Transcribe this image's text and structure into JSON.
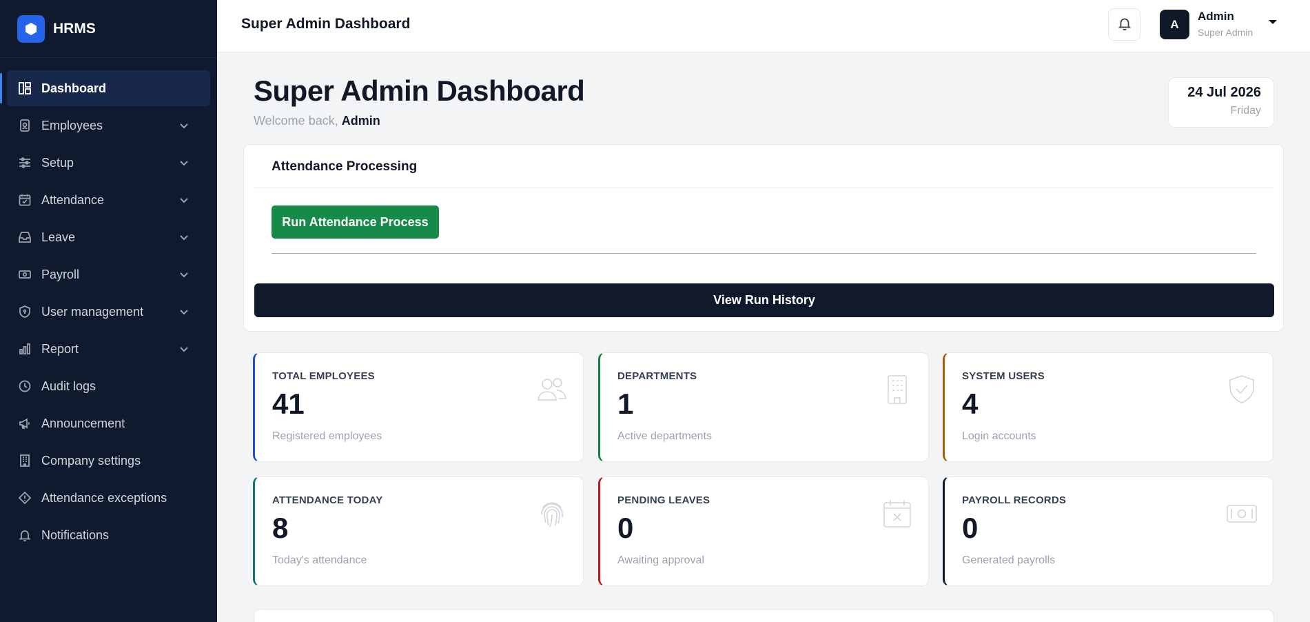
{
  "brand": {
    "name": "HRMS",
    "icon": "hexagon-icon",
    "color": "#2563eb"
  },
  "sidebar": {
    "items": [
      {
        "label": "Dashboard",
        "icon": "dashboard-icon",
        "active": true,
        "expandable": false
      },
      {
        "label": "Employees",
        "icon": "id-badge-icon",
        "expandable": true
      },
      {
        "label": "Setup",
        "icon": "sliders-icon",
        "expandable": true
      },
      {
        "label": "Attendance",
        "icon": "calendar-check-icon",
        "expandable": true
      },
      {
        "label": "Leave",
        "icon": "inbox-icon",
        "expandable": true
      },
      {
        "label": "Payroll",
        "icon": "money-icon",
        "expandable": true
      },
      {
        "label": "User management",
        "icon": "shield-icon",
        "expandable": true
      },
      {
        "label": "Report",
        "icon": "bar-chart-icon",
        "expandable": true
      },
      {
        "label": "Audit logs",
        "icon": "clock-icon",
        "expandable": false
      },
      {
        "label": "Announcement",
        "icon": "megaphone-icon",
        "expandable": false
      },
      {
        "label": "Company settings",
        "icon": "building-icon",
        "expandable": false
      },
      {
        "label": "Attendance exceptions",
        "icon": "alert-diamond-icon",
        "expandable": false
      },
      {
        "label": "Notifications",
        "icon": "bell-icon",
        "expandable": false
      }
    ]
  },
  "topbar": {
    "title": "Super Admin Dashboard",
    "user": {
      "initial": "A",
      "name": "Admin",
      "role": "Super Admin"
    }
  },
  "main": {
    "title": "Super Admin Dashboard",
    "welcome_prefix": "Welcome back,",
    "welcome_name": "Admin",
    "date": "24 Jul 2026",
    "day": "Friday",
    "attendance": {
      "title": "Attendance Processing",
      "run_button": "Run Attendance Process",
      "history_button": "View Run History"
    },
    "stats": [
      {
        "label": "TOTAL EMPLOYEES",
        "value": "41",
        "sub": "Registered employees",
        "icon": "users-icon",
        "color": "#1d4ed8"
      },
      {
        "label": "DEPARTMENTS",
        "value": "1",
        "sub": "Active departments",
        "icon": "building-icon",
        "color": "#15803d"
      },
      {
        "label": "SYSTEM USERS",
        "value": "4",
        "sub": "Login accounts",
        "icon": "shield-check-icon",
        "color": "#a16207"
      },
      {
        "label": "ATTENDANCE TODAY",
        "value": "8",
        "sub": "Today's attendance",
        "icon": "fingerprint-icon",
        "color": "#0f766e"
      },
      {
        "label": "PENDING LEAVES",
        "value": "0",
        "sub": "Awaiting approval",
        "icon": "calendar-x-icon",
        "color": "#b91c1c"
      },
      {
        "label": "PAYROLL RECORDS",
        "value": "0",
        "sub": "Generated payrolls",
        "icon": "banknote-icon",
        "color": "#111827"
      }
    ]
  }
}
